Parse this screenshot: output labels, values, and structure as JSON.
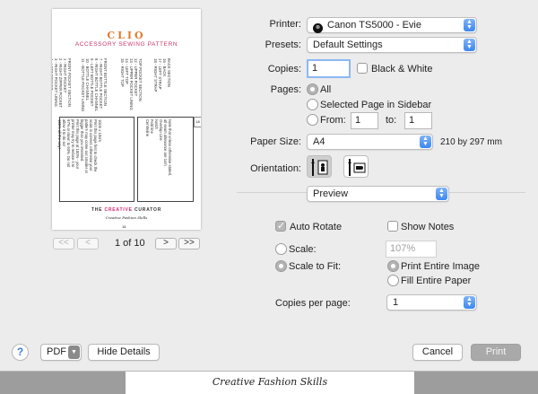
{
  "preview": {
    "title": "CLIO",
    "subtitle": "ACCESSORY SEWING PATTERN",
    "columns": [
      [
        "FRONT POCKET SECTION",
        "1 - RIGHT POCKET",
        "2 - RIGHT ZIPPER POCKET",
        "3 - RIGHT POCKET LINING",
        "4 - LEFT POCKET",
        "5 - LEFT BOTTOM POCKET",
        "6 - LEFT POCKET LINING"
      ],
      [
        "FRONT BOTTLE SECTION",
        "7 - RIGHT BOTTLE POCKET",
        "8 - RIGHT BOTTLE CHANNEL",
        "9 - LEFT BOTTLE POCKET",
        "10 - BOTTLE CHANNEL",
        "11 - BOTTLE POCKET LINING"
      ],
      [
        "TOP POCKET SECTION",
        "12 - UPPER POCKET",
        "13 - UPPER POCKET LINING",
        "14 - LEFT TOP",
        "15 - RIGHT TOP"
      ],
      [
        "BACK SECTION",
        "16 - BACK",
        "17 - LEFT STRAP",
        "18 - RIGHT STRAP"
      ]
    ],
    "box_left_lines": [
      "10cm x 10cm",
      "Print this page first to check the",
      "scale is correct, otherwise your",
      "pattern may come out smaller or",
      "bigger than you intended.",
      "Print this page at 100% - your",
      "printer may try to reduce it to",
      "97% or down to 93%. Do not",
      "allow it to do so!",
      "100% all the way!"
    ],
    "box_right_lines": [
      "Note that unless otherwise stated,",
      "all seam allowance are 1cm",
      "Overlap Line",
      "Notch",
      "Fold line",
      "Centreline"
    ],
    "brand": "THE CREATIVE CURATOR",
    "brand_colored": "CREATIVE",
    "tagline": "Creative Fashion Skills",
    "page_number": "18",
    "side_tab_number": "18"
  },
  "pager": {
    "first": "<<",
    "prev": "<",
    "label": "1 of 10",
    "next": ">",
    "last": ">>"
  },
  "form": {
    "printer_label": "Printer:",
    "printer_value": "Canon TS5000 - Evie",
    "printer_icon": "canon-printer-icon",
    "presets_label": "Presets:",
    "presets_value": "Default Settings",
    "copies_label": "Copies:",
    "copies_value": "1",
    "bw_label": "Black & White",
    "pages_label": "Pages:",
    "pages_all": "All",
    "pages_selected": "Selected Page in Sidebar",
    "pages_from": "From:",
    "pages_from_value": "1",
    "pages_to": "to:",
    "pages_to_value": "1",
    "paper_size_label": "Paper Size:",
    "paper_size_value": "A4",
    "paper_size_dims": "210 by 297 mm",
    "orientation_label": "Orientation:",
    "section_value": "Preview",
    "auto_rotate_label": "Auto Rotate",
    "show_notes_label": "Show Notes",
    "scale_label": "Scale:",
    "scale_value": "107%",
    "scale_to_fit_label": "Scale to Fit:",
    "print_entire_image": "Print Entire Image",
    "fill_entire_paper": "Fill Entire Paper",
    "copies_per_page_label": "Copies per page:",
    "copies_per_page_value": "1"
  },
  "footer": {
    "help": "?",
    "pdf_label": "PDF",
    "hide_details": "Hide Details",
    "cancel": "Cancel",
    "print": "Print"
  },
  "background_page": {
    "signature": "Creative Fashion Skills"
  },
  "colors": {
    "accent_blue": "#3c87f0",
    "title_orange": "#e07a2e",
    "brand_pink": "#d2246f"
  }
}
